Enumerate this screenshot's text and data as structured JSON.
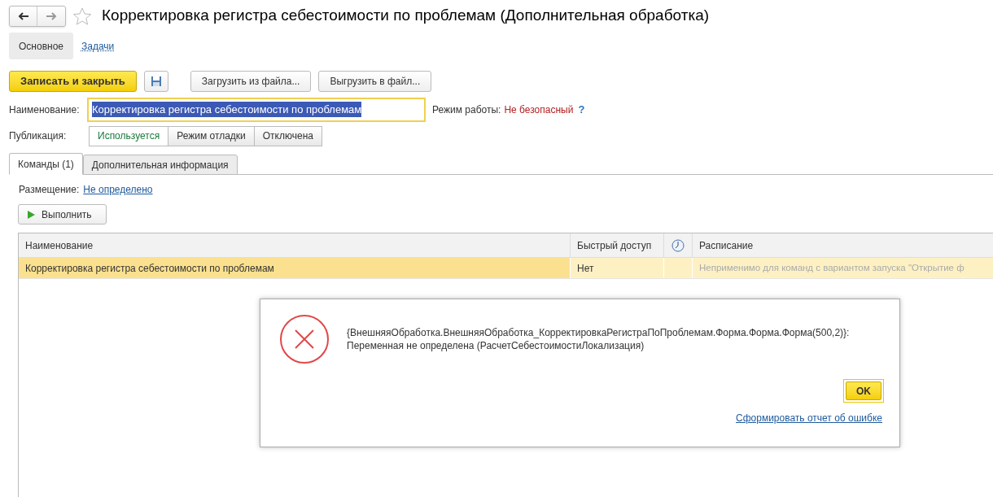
{
  "window": {
    "title": "Корректировка регистра себестоимости по проблемам (Дополнительная обработка)"
  },
  "nav_tabs": [
    {
      "label": "Основное",
      "selected": true
    },
    {
      "label": "Задачи",
      "selected": false
    }
  ],
  "toolbar": {
    "primary": "Записать и закрыть",
    "buttons": [
      "Загрузить из файла...",
      "Выгрузить в файл..."
    ]
  },
  "name_field": {
    "label": "Наименование:",
    "value": "Корректировка регистра себестоимости по проблемам"
  },
  "mode": {
    "label": "Режим работы:",
    "value": "Не безопасный",
    "help": "?"
  },
  "publication": {
    "label": "Публикация:",
    "options": [
      {
        "label": "Используется",
        "selected": true
      },
      {
        "label": "Режим отладки",
        "selected": false
      },
      {
        "label": "Отключена",
        "selected": false
      }
    ]
  },
  "tabs": [
    {
      "label": "Команды (1)",
      "selected": true
    },
    {
      "label": "Дополнительная информация",
      "selected": false
    }
  ],
  "placement": {
    "label": "Размещение:",
    "value": "Не определено"
  },
  "run_button": "Выполнить",
  "table": {
    "columns": [
      "Наименование",
      "Быстрый доступ",
      "",
      "Расписание"
    ],
    "rows": [
      {
        "selected": true,
        "cells": [
          "Корректировка регистра себестоимости по проблемам",
          "Нет",
          "",
          "Неприменимо для команд с вариантом запуска \"Открытие ф"
        ]
      }
    ]
  },
  "dialog": {
    "message": [
      "{ВнешняяОбработка.ВнешняяОбработка_КорректировкаРегистраПоПроблемам.Форма.Форма.Форма(500,2)}:",
      "Переменная не определена (РасчетСебестоимостиЛокализация)"
    ],
    "ok": "OK",
    "report_link": "Сформировать отчет об ошибке"
  }
}
